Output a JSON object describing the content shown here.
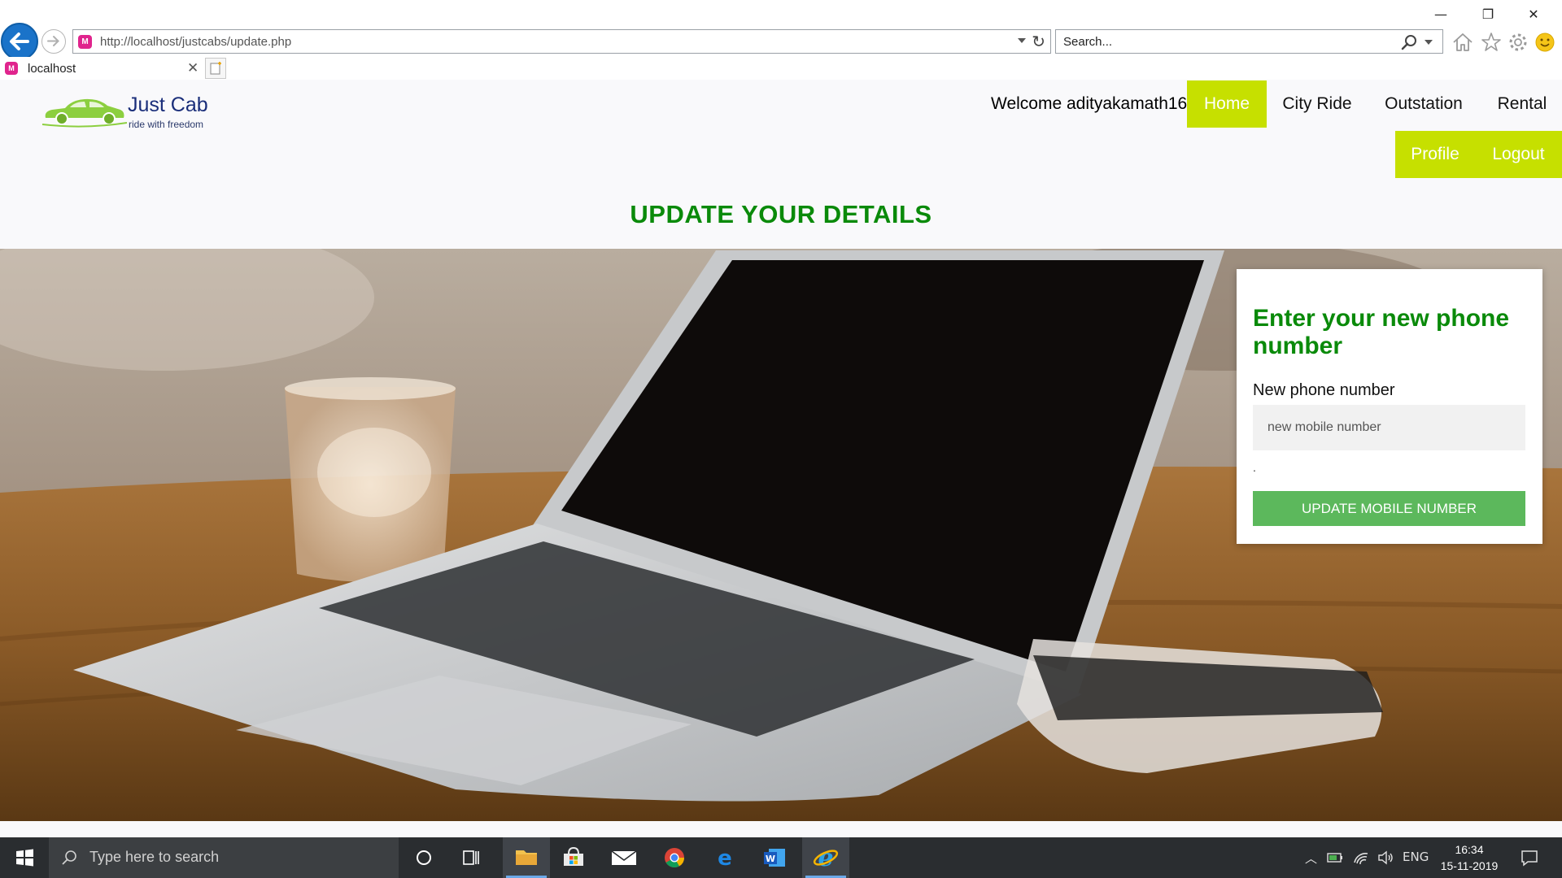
{
  "browser": {
    "url": "http://localhost/justcabs/update.php",
    "search_placeholder": "Search...",
    "tab_title": "localhost",
    "window_controls": {
      "minimize": "—",
      "restore": "❐",
      "close": "✕"
    }
  },
  "header": {
    "brand": "Just Cab",
    "tagline": "ride with freedom",
    "welcome": "Welcome adityakamath16 .",
    "nav": {
      "home": "Home",
      "city_ride": "City Ride",
      "outstation": "Outstation",
      "rental": "Rental",
      "profile": "Profile",
      "logout": "Logout"
    },
    "accent_color": "#c6e000"
  },
  "page": {
    "title": "UPDATE YOUR DETAILS",
    "title_color": "#0a8a0a"
  },
  "form": {
    "heading": "Enter your new phone number",
    "label": "New phone number",
    "input_placeholder": "new mobile number",
    "note": ".",
    "submit": "UPDATE MOBILE NUMBER",
    "submit_color": "#5cb85c"
  },
  "taskbar": {
    "search_placeholder": "Type here to search",
    "language": "ENG",
    "time": "16:34",
    "date": "15-11-2019",
    "apps": [
      "task-view",
      "file-explorer",
      "microsoft-store",
      "mail",
      "chrome",
      "edge",
      "word",
      "internet-explorer"
    ]
  }
}
